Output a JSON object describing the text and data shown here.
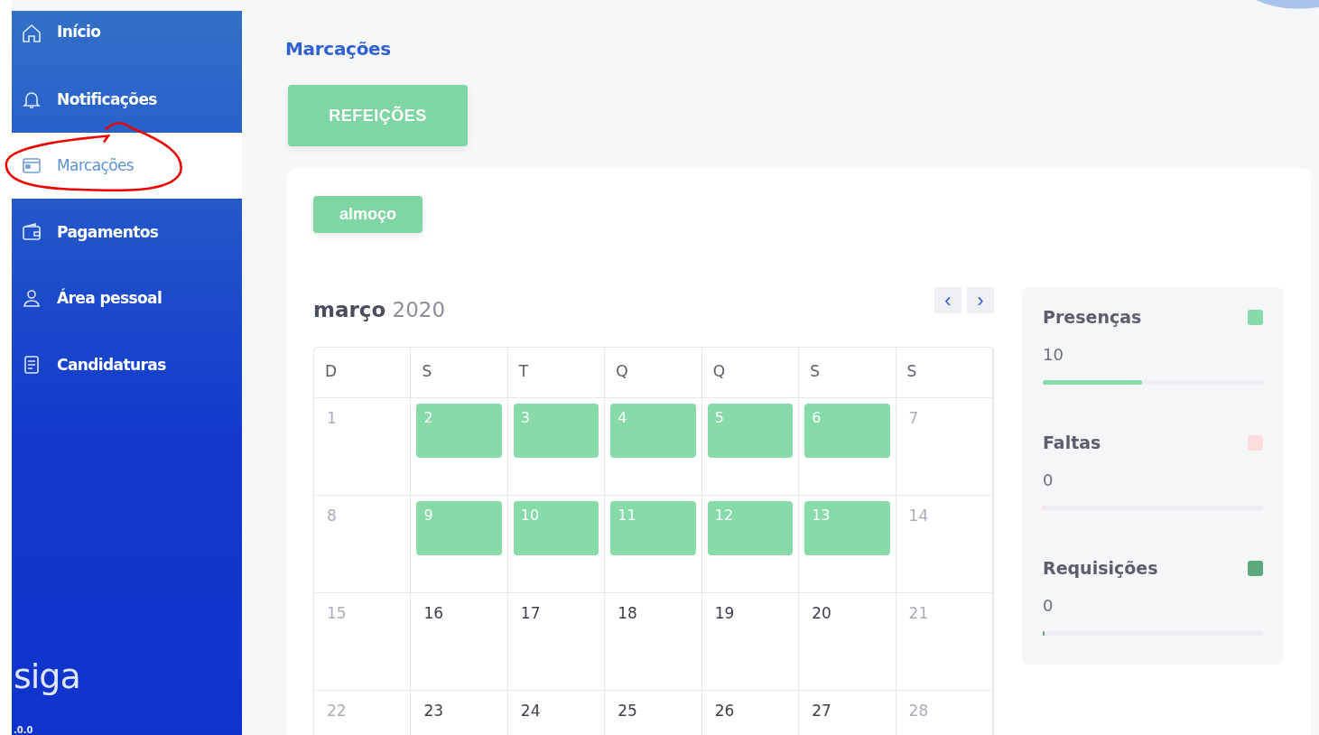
{
  "sidebar": {
    "items": [
      {
        "label": "Início",
        "selected": false
      },
      {
        "label": "Notificações",
        "selected": false
      },
      {
        "label": "Marcações",
        "selected": true
      },
      {
        "label": "Pagamentos",
        "selected": false
      },
      {
        "label": "Área pessoal",
        "selected": false
      },
      {
        "label": "Candidaturas",
        "selected": false
      }
    ],
    "logo": "siga",
    "version": ".0.0"
  },
  "page_title": "Marcações",
  "meals_button": "REFEIÇÕES",
  "meal_tag": "almoço",
  "calendar": {
    "month": "março",
    "year": "2020",
    "prev": "‹",
    "next": "›",
    "weekdays": [
      "D",
      "S",
      "T",
      "Q",
      "Q",
      "S",
      "S"
    ],
    "weeks": [
      [
        {
          "day": "1",
          "muted": true,
          "marked": false
        },
        {
          "day": "2",
          "muted": false,
          "marked": true
        },
        {
          "day": "3",
          "muted": false,
          "marked": true
        },
        {
          "day": "4",
          "muted": false,
          "marked": true
        },
        {
          "day": "5",
          "muted": false,
          "marked": true
        },
        {
          "day": "6",
          "muted": false,
          "marked": true
        },
        {
          "day": "7",
          "muted": true,
          "marked": false
        }
      ],
      [
        {
          "day": "8",
          "muted": true,
          "marked": false
        },
        {
          "day": "9",
          "muted": false,
          "marked": true
        },
        {
          "day": "10",
          "muted": false,
          "marked": true
        },
        {
          "day": "11",
          "muted": false,
          "marked": true
        },
        {
          "day": "12",
          "muted": false,
          "marked": true
        },
        {
          "day": "13",
          "muted": false,
          "marked": true
        },
        {
          "day": "14",
          "muted": true,
          "marked": false
        }
      ],
      [
        {
          "day": "15",
          "muted": true,
          "marked": false
        },
        {
          "day": "16",
          "muted": false,
          "marked": false
        },
        {
          "day": "17",
          "muted": false,
          "marked": false
        },
        {
          "day": "18",
          "muted": false,
          "marked": false
        },
        {
          "day": "19",
          "muted": false,
          "marked": false
        },
        {
          "day": "20",
          "muted": false,
          "marked": false
        },
        {
          "day": "21",
          "muted": true,
          "marked": false
        }
      ],
      [
        {
          "day": "22",
          "muted": true,
          "marked": false
        },
        {
          "day": "23",
          "muted": false,
          "marked": false
        },
        {
          "day": "24",
          "muted": false,
          "marked": false
        },
        {
          "day": "25",
          "muted": false,
          "marked": false
        },
        {
          "day": "26",
          "muted": false,
          "marked": false
        },
        {
          "day": "27",
          "muted": false,
          "marked": false
        },
        {
          "day": "28",
          "muted": true,
          "marked": false
        }
      ]
    ]
  },
  "stats": [
    {
      "label": "Presenças",
      "value": "10",
      "color": "#86dba8",
      "level": 0.45
    },
    {
      "label": "Faltas",
      "value": "0",
      "color": "#fcdcdc",
      "level": 0
    },
    {
      "label": "Requisições",
      "value": "0",
      "color": "#5aa97a",
      "level": 0
    }
  ]
}
